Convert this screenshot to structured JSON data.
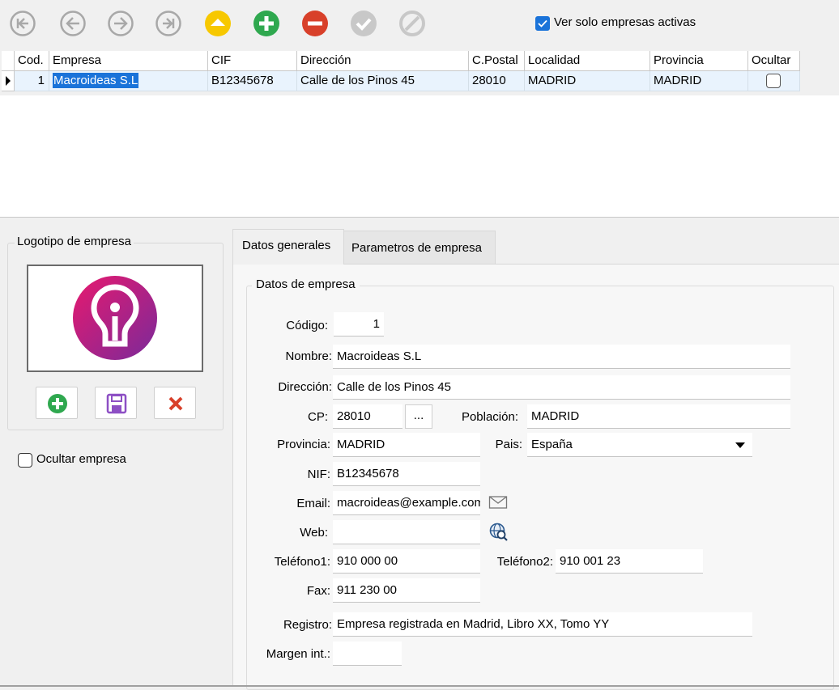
{
  "toolbar": {
    "buttons": [
      {
        "name": "first-record-icon",
        "color": "#a8a8a8"
      },
      {
        "name": "previous-record-icon",
        "color": "#a8a8a8"
      },
      {
        "name": "next-record-icon",
        "color": "#a8a8a8"
      },
      {
        "name": "last-record-icon",
        "color": "#a8a8a8"
      },
      {
        "name": "edit-record-icon",
        "color": "#f7c800"
      },
      {
        "name": "add-record-icon",
        "color": "#2fa84f"
      },
      {
        "name": "delete-record-icon",
        "color": "#d8402a"
      },
      {
        "name": "confirm-icon",
        "color": "#c8c8c8"
      },
      {
        "name": "cancel-icon",
        "color": "#c8c8c8"
      }
    ],
    "active_only_label": "Ver solo empresas activas",
    "active_only_checked": true
  },
  "grid": {
    "columns": [
      "Cod.",
      "Empresa",
      "CIF",
      "Dirección",
      "C.Postal",
      "Localidad",
      "Provincia",
      "Ocultar"
    ],
    "rows": [
      {
        "cod": "1",
        "empresa": "Macroideas S.L",
        "cif": "B12345678",
        "direccion": "Calle de los Pinos 45",
        "cpostal": "28010",
        "localidad": "MADRID",
        "provincia": "MADRID",
        "ocultar": false
      }
    ]
  },
  "logo_panel": {
    "title": "Logotipo de empresa",
    "buttons": [
      "add-logo-icon",
      "save-logo-icon",
      "remove-logo-icon"
    ]
  },
  "hide_company": {
    "label": "Ocultar empresa",
    "checked": false
  },
  "tabs": [
    {
      "label": "Datos generales",
      "active": true
    },
    {
      "label": "Parametros de empresa",
      "active": false
    }
  ],
  "form": {
    "group_title": "Datos de empresa",
    "codigo": {
      "label": "Código:",
      "value": "1"
    },
    "nombre": {
      "label": "Nombre:",
      "value": "Macroideas S.L"
    },
    "direccion": {
      "label": "Dirección:",
      "value": "Calle de los Pinos 45"
    },
    "cp": {
      "label": "CP:",
      "value": "28010",
      "browse": "..."
    },
    "poblacion": {
      "label": "Población:",
      "value": "MADRID"
    },
    "provincia": {
      "label": "Provincia:",
      "value": "MADRID"
    },
    "pais": {
      "label": "Pais:",
      "value": "España"
    },
    "nif": {
      "label": "NIF:",
      "value": "B12345678"
    },
    "email": {
      "label": "Email:",
      "value": "macroideas@example.com"
    },
    "web": {
      "label": "Web:",
      "value": ""
    },
    "telefono1": {
      "label": "Teléfono1:",
      "value": "910 000 00"
    },
    "telefono2": {
      "label": "Teléfono2:",
      "value": "910 001 23"
    },
    "fax": {
      "label": "Fax:",
      "value": "911 230 00"
    },
    "registro": {
      "label": "Registro:",
      "value": "Empresa registrada en Madrid, Libro XX, Tomo YY"
    },
    "margen": {
      "label": "Margen int.:",
      "value": ""
    }
  },
  "colors": {
    "selection": "#1a73d9",
    "row_highlight": "#e9f3fd",
    "logo_gradient_start": "#e8196e",
    "logo_gradient_end": "#7a2a9a"
  }
}
